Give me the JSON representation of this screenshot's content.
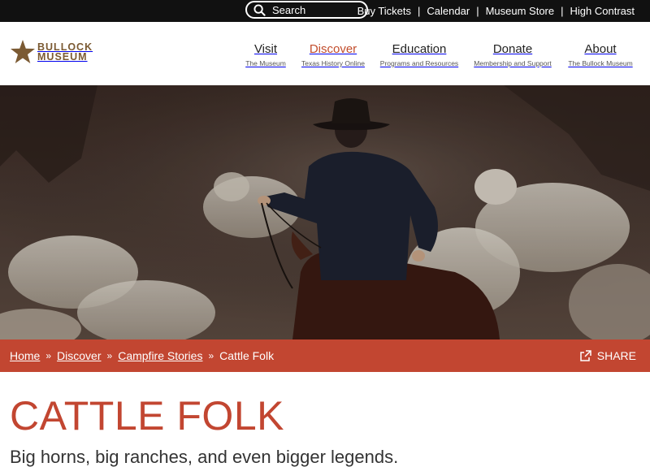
{
  "topbar": {
    "search_placeholder": "Search",
    "links": [
      "Buy Tickets",
      "Calendar",
      "Museum Store",
      "High Contrast"
    ]
  },
  "logo": {
    "line1": "BULLOCK",
    "line2": "MUSEUM"
  },
  "nav": [
    {
      "title": "Visit",
      "sub": "The Museum"
    },
    {
      "title": "Discover",
      "sub": "Texas History Online",
      "active": true
    },
    {
      "title": "Education",
      "sub": "Programs and Resources"
    },
    {
      "title": "Donate",
      "sub": "Membership and Support"
    },
    {
      "title": "About",
      "sub": "The Bullock Museum"
    }
  ],
  "breadcrumb": {
    "items": [
      "Home",
      "Discover",
      "Campfire Stories"
    ],
    "current": "Cattle Folk",
    "separator": "»"
  },
  "share_label": "SHARE",
  "page": {
    "title": "CATTLE FOLK",
    "subtitle": "Big horns, big ranches, and even bigger legends."
  },
  "colors": {
    "accent": "#c24631",
    "topbar": "#111111",
    "logo": "#7b5a33"
  }
}
